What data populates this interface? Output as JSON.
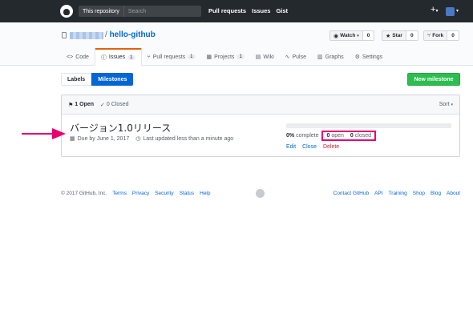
{
  "header": {
    "search_scope": "This repository",
    "search_placeholder": "Search",
    "nav": [
      "Pull requests",
      "Issues",
      "Gist"
    ],
    "plus_label": "+",
    "caret": "▾"
  },
  "repo": {
    "slash": "/",
    "name": "hello-github",
    "buttons": {
      "watch_label": "Watch",
      "watch_count": "0",
      "star_label": "Star",
      "star_count": "0",
      "fork_label": "Fork",
      "fork_count": "0"
    },
    "tabs": [
      {
        "label": "Code",
        "icon": "<>"
      },
      {
        "label": "Issues",
        "icon": "ⓘ",
        "count": "1"
      },
      {
        "label": "Pull requests",
        "icon": "⑂",
        "count": "1"
      },
      {
        "label": "Projects",
        "icon": "▦",
        "count": "1"
      },
      {
        "label": "Wiki",
        "icon": "▤"
      },
      {
        "label": "Pulse",
        "icon": "∿"
      },
      {
        "label": "Graphs",
        "icon": "▥"
      },
      {
        "label": "Settings",
        "icon": "⚙"
      }
    ]
  },
  "subnav": {
    "labels": "Labels",
    "milestones": "Milestones",
    "new_milestone": "New milestone"
  },
  "milestones": {
    "open": "1 Open",
    "closed": "0 Closed",
    "sort": "Sort",
    "item": {
      "title": "バージョン1.0リリース",
      "due": "Due by June 1, 2017",
      "updated": "Last updated less than a minute ago",
      "progress_percent": 0,
      "complete_pct": "0%",
      "complete_label": "complete",
      "open_count": "0",
      "open_label": "open",
      "closed_count": "0",
      "closed_label": "closed",
      "edit": "Edit",
      "close": "Close",
      "delete": "Delete"
    }
  },
  "footer": {
    "copyright": "© 2017 GitHub, Inc.",
    "left_links": [
      "Terms",
      "Privacy",
      "Security",
      "Status",
      "Help"
    ],
    "right_links": [
      "Contact GitHub",
      "API",
      "Training",
      "Shop",
      "Blog",
      "About"
    ]
  },
  "colors": {
    "header_bg": "#24292e",
    "link": "#0366d6",
    "green": "#2cbe4e",
    "highlight": "#e7006f",
    "delete": "#cb2431"
  }
}
